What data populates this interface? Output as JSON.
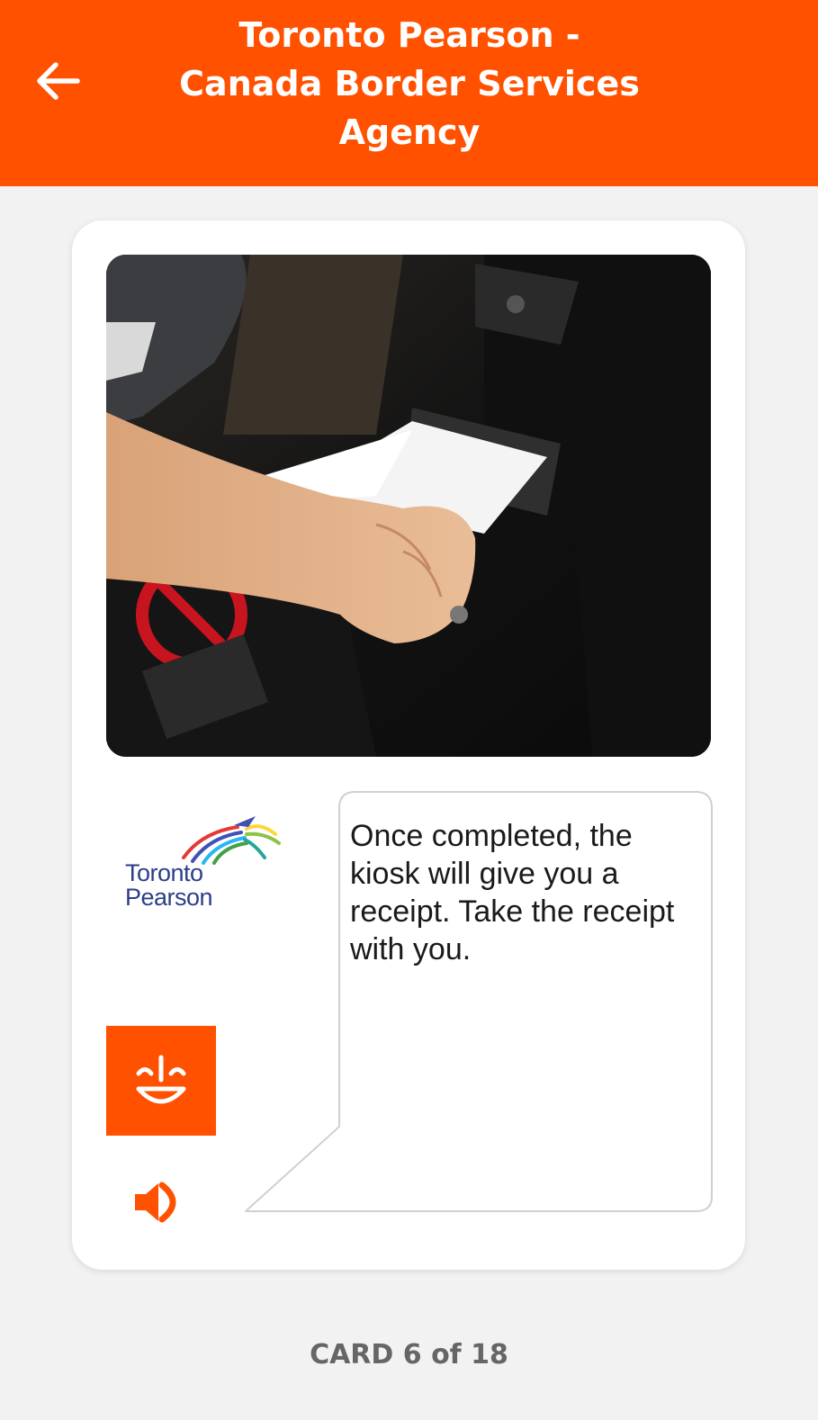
{
  "header": {
    "title": "Toronto Pearson - Canada Border Services Agency",
    "back_icon": "arrow-left-icon",
    "background_color": "#ff5100"
  },
  "card": {
    "image_icon": "kiosk-receipt-photo",
    "logo": {
      "line1": "Toronto",
      "line2": "Pearson",
      "icon": "toronto-pearson-logo"
    },
    "message": "Once completed, the kiosk will give you a receipt. Take the receipt with you.",
    "smile_icon": "smiley-face-icon",
    "speaker_icon": "speaker-icon"
  },
  "footer": {
    "counter": "CARD 6 of 18"
  },
  "colors": {
    "accent": "#ff5100",
    "background": "#f2f2f2",
    "card": "#ffffff",
    "logo_text": "#2c3e88"
  }
}
